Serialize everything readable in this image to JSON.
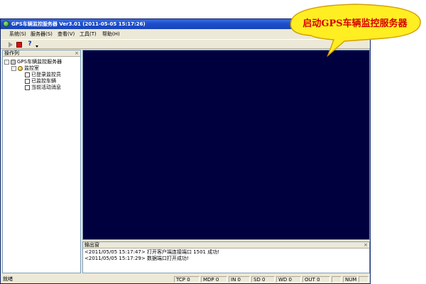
{
  "window": {
    "title": "GPS车辆监控服务器 Ver3.01  (2011-05-05 15:17:26)"
  },
  "menubar": [
    {
      "label": "系统(S)"
    },
    {
      "label": "服务器(S)"
    },
    {
      "label": "查看(V)"
    },
    {
      "label": "工具(T)"
    },
    {
      "label": "帮助(H)"
    }
  ],
  "toolbar": {
    "buttons": [
      {
        "icon": "play-icon"
      },
      {
        "icon": "stop-icon"
      },
      {
        "icon": "help-icon"
      },
      {
        "icon": "dropdown-arrow-icon"
      }
    ]
  },
  "left_panel": {
    "title": "操作列",
    "close_glyph": "×",
    "tree": [
      {
        "label": "GPS车辆监控服务器",
        "toggle": "-"
      },
      {
        "label": "监控室",
        "toggle": "-"
      },
      {
        "label": "已登录监控员"
      },
      {
        "label": "已监控车辆"
      },
      {
        "label": "当前活动消息"
      }
    ]
  },
  "output_panel": {
    "title": "输出窗",
    "close_glyph": "×",
    "lines": [
      "<2011/05/05 15:17:47>  打开客户端连接端口 1501 成功!",
      "<2011/05/05 15:17:29>  数据端口打开成功!"
    ]
  },
  "statusbar": {
    "ready": "就绪",
    "cells": [
      "TCP 0",
      "MDP 0",
      "IN 0",
      "SD 0",
      "WD 0",
      "OUT 0",
      "",
      "NUM",
      ""
    ]
  },
  "callout": {
    "text": "启动GPS车辆监控服务器",
    "fill": "#ffee22",
    "stroke": "#d4a000",
    "text_color": "#d80000"
  },
  "colors": {
    "display_bg": "#00003e",
    "titlebar": "#1d4fcb"
  }
}
